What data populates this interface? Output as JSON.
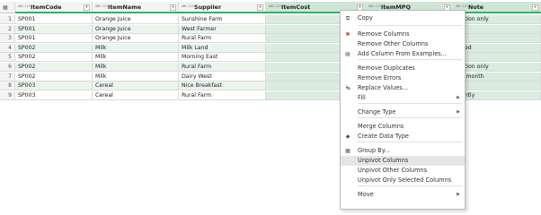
{
  "columns": [
    {
      "name": "ItemCode",
      "type_icon": "ABC 123"
    },
    {
      "name": "ItemName",
      "type_icon": "ABC 123"
    },
    {
      "name": "Supplier",
      "type_icon": "ABC 123"
    },
    {
      "name": "ItemCost",
      "type_icon": "ABC 123"
    },
    {
      "name": "ItemMPQ",
      "type_icon": "ABC 123"
    },
    {
      "name": "Note",
      "type_icon": "ABC 123"
    }
  ],
  "rows": [
    {
      "num": "1",
      "code": "SP001",
      "name": "Orange Juice",
      "supplier": "Sunshine Farm",
      "note": "motion only"
    },
    {
      "num": "2",
      "code": "SP001",
      "name": "Orange Juice",
      "supplier": "West Farmer",
      "note": ""
    },
    {
      "num": "3",
      "code": "SP001",
      "name": "Orange Juice",
      "supplier": "Rural Farm",
      "note": ""
    },
    {
      "num": "4",
      "code": "SP002",
      "name": "Milk",
      "supplier": "Milk Land",
      "note": "rtised"
    },
    {
      "num": "5",
      "code": "SP002",
      "name": "Milk",
      "supplier": "Morning East",
      "note": ""
    },
    {
      "num": "6",
      "code": "SP002",
      "name": "Milk",
      "supplier": "Rural Farm",
      "note": "motion only"
    },
    {
      "num": "7",
      "code": "SP002",
      "name": "Milk",
      "supplier": "Dairy West",
      "note": "e a month"
    },
    {
      "num": "8",
      "code": "SP003",
      "name": "Cereal",
      "supplier": "Nice Breakfast",
      "note": ""
    },
    {
      "num": "9",
      "code": "SP003",
      "name": "Cereal",
      "supplier": "Rural Farm",
      "note": "nightly"
    }
  ],
  "colors": {
    "quality_bar": "#2fb36a",
    "selected_header": "#cfe6d6",
    "menu_hover": "#e5e5e5"
  },
  "menu": {
    "items": [
      {
        "label": "Copy",
        "icon": "copy-icon"
      },
      {
        "label": "Remove Columns",
        "icon": "remove-columns-icon"
      },
      {
        "label": "Remove Other Columns",
        "icon": ""
      },
      {
        "label": "Add Column From Examples...",
        "icon": "add-column-icon"
      },
      {
        "label": "Remove Duplicates",
        "icon": ""
      },
      {
        "label": "Remove Errors",
        "icon": ""
      },
      {
        "label": "Replace Values...",
        "icon": "replace-icon"
      },
      {
        "label": "Fill",
        "icon": "",
        "submenu": true
      },
      {
        "label": "Change Type",
        "icon": "",
        "submenu": true
      },
      {
        "label": "Merge Columns",
        "icon": ""
      },
      {
        "label": "Create Data Type",
        "icon": "data-type-icon"
      },
      {
        "label": "Group By...",
        "icon": "group-by-icon"
      },
      {
        "label": "Unpivot Columns",
        "icon": "",
        "hover": true
      },
      {
        "label": "Unpivot Other Columns",
        "icon": ""
      },
      {
        "label": "Unpivot Only Selected Columns",
        "icon": ""
      },
      {
        "label": "Move",
        "icon": "",
        "submenu": true
      }
    ]
  }
}
